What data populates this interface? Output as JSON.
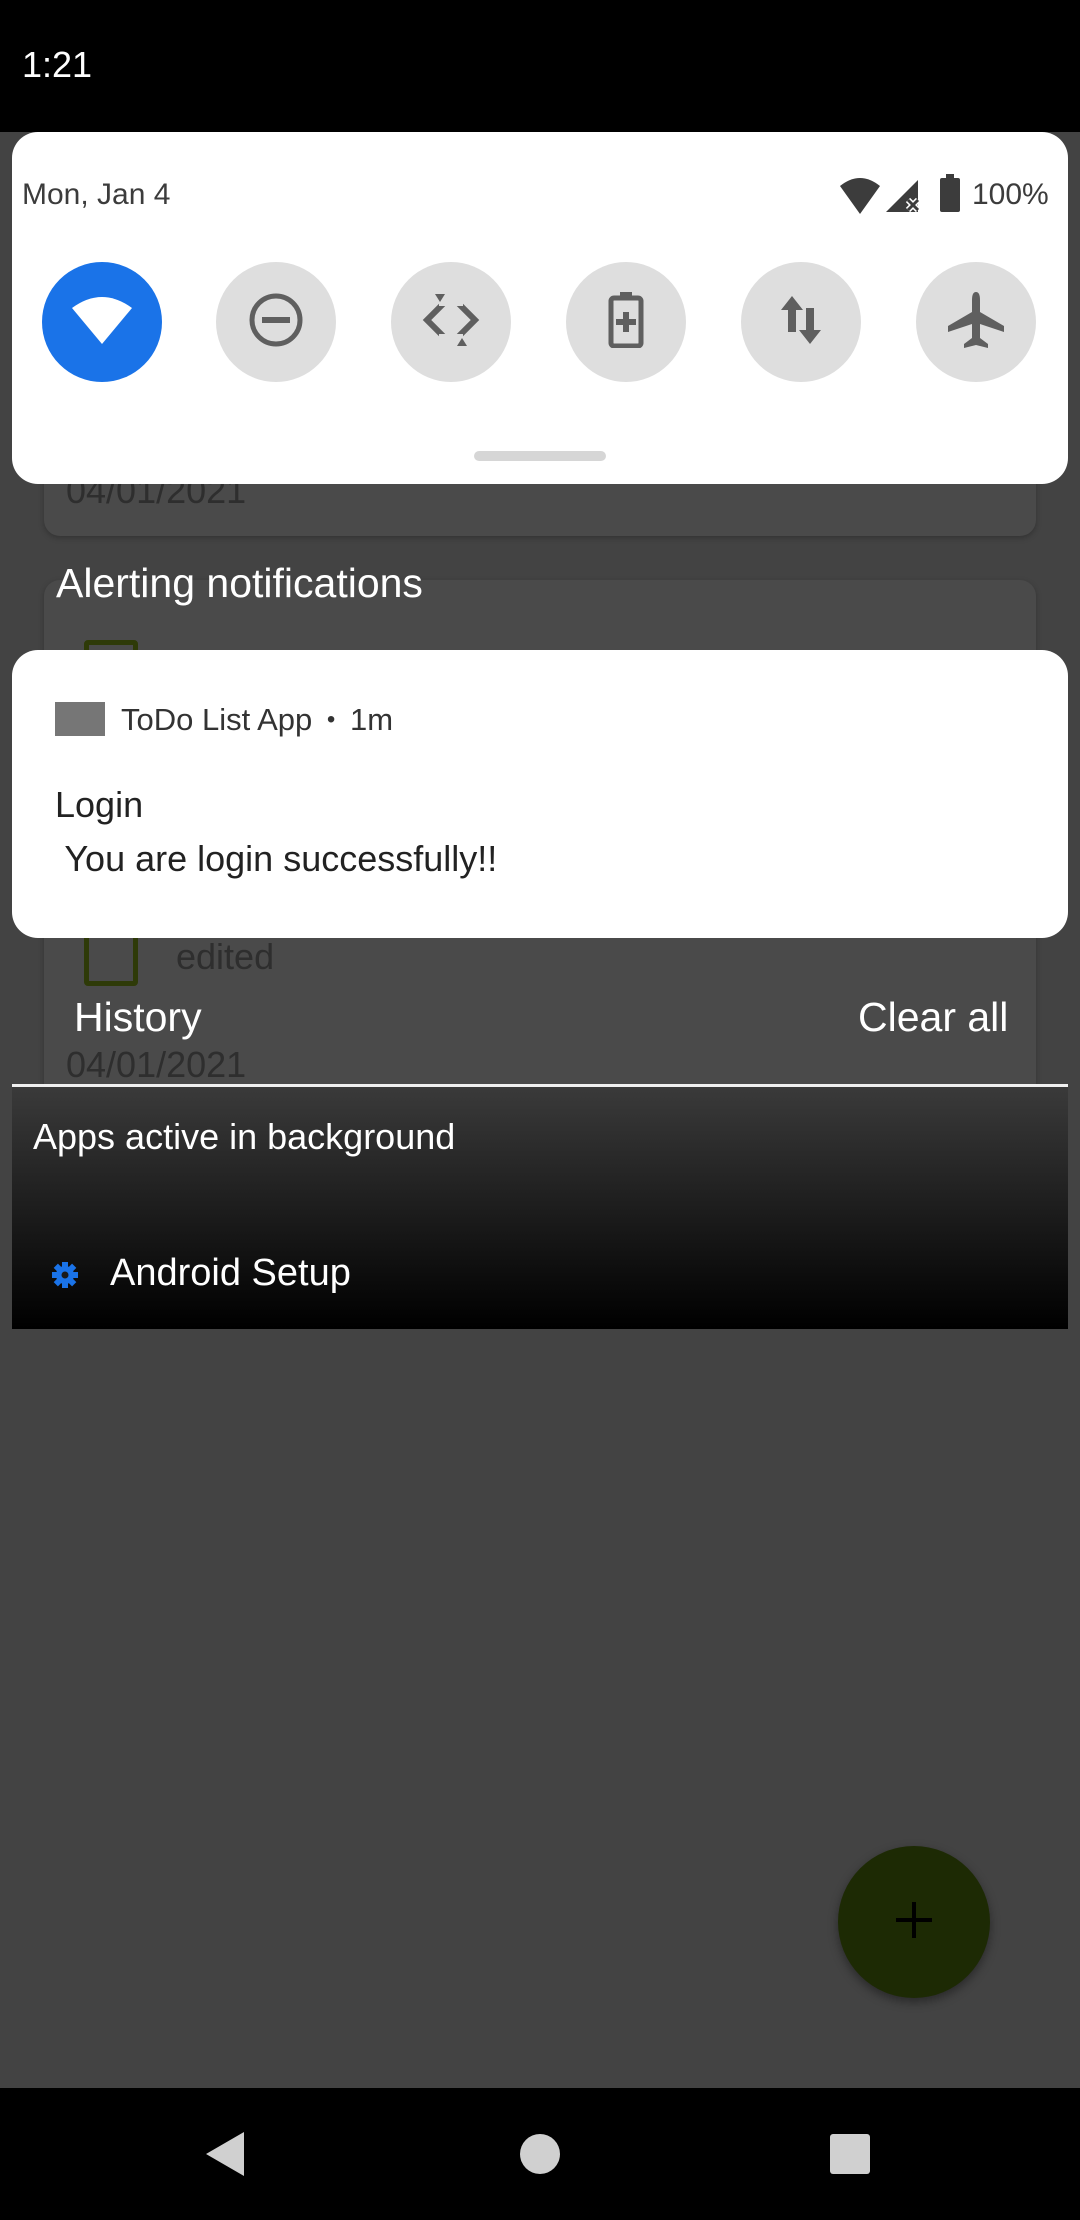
{
  "status_bar": {
    "time": "1:21"
  },
  "quick_settings": {
    "date": "Mon, Jan 4",
    "battery_percent": "100%",
    "tiles": [
      {
        "name": "wifi",
        "state": "on"
      },
      {
        "name": "do-not-disturb",
        "state": "off"
      },
      {
        "name": "auto-rotate",
        "state": "off"
      },
      {
        "name": "battery-saver",
        "state": "off"
      },
      {
        "name": "mobile-data",
        "state": "off"
      },
      {
        "name": "airplane-mode",
        "state": "off"
      }
    ],
    "accent_color": "#1a73e8"
  },
  "background_app": {
    "top_date": "04/01/2021",
    "item_label": "edited",
    "item_date": "04/01/2021"
  },
  "notifications": {
    "section_label": "Alerting notifications",
    "items": [
      {
        "app_name": "ToDo List App",
        "separator": "•",
        "time": "1m",
        "title": "Login",
        "text": " You are login successfully!!"
      }
    ]
  },
  "history_row": {
    "history_label": "History",
    "clear_all_label": "Clear all"
  },
  "background_apps": {
    "label": "Apps active in background",
    "apps": [
      {
        "name": "Android Setup",
        "icon": "gear-icon",
        "icon_color": "#1a73e8"
      }
    ]
  },
  "fab": {
    "icon": "plus-icon"
  },
  "navigation": {
    "buttons": [
      "back",
      "home",
      "recents"
    ]
  }
}
